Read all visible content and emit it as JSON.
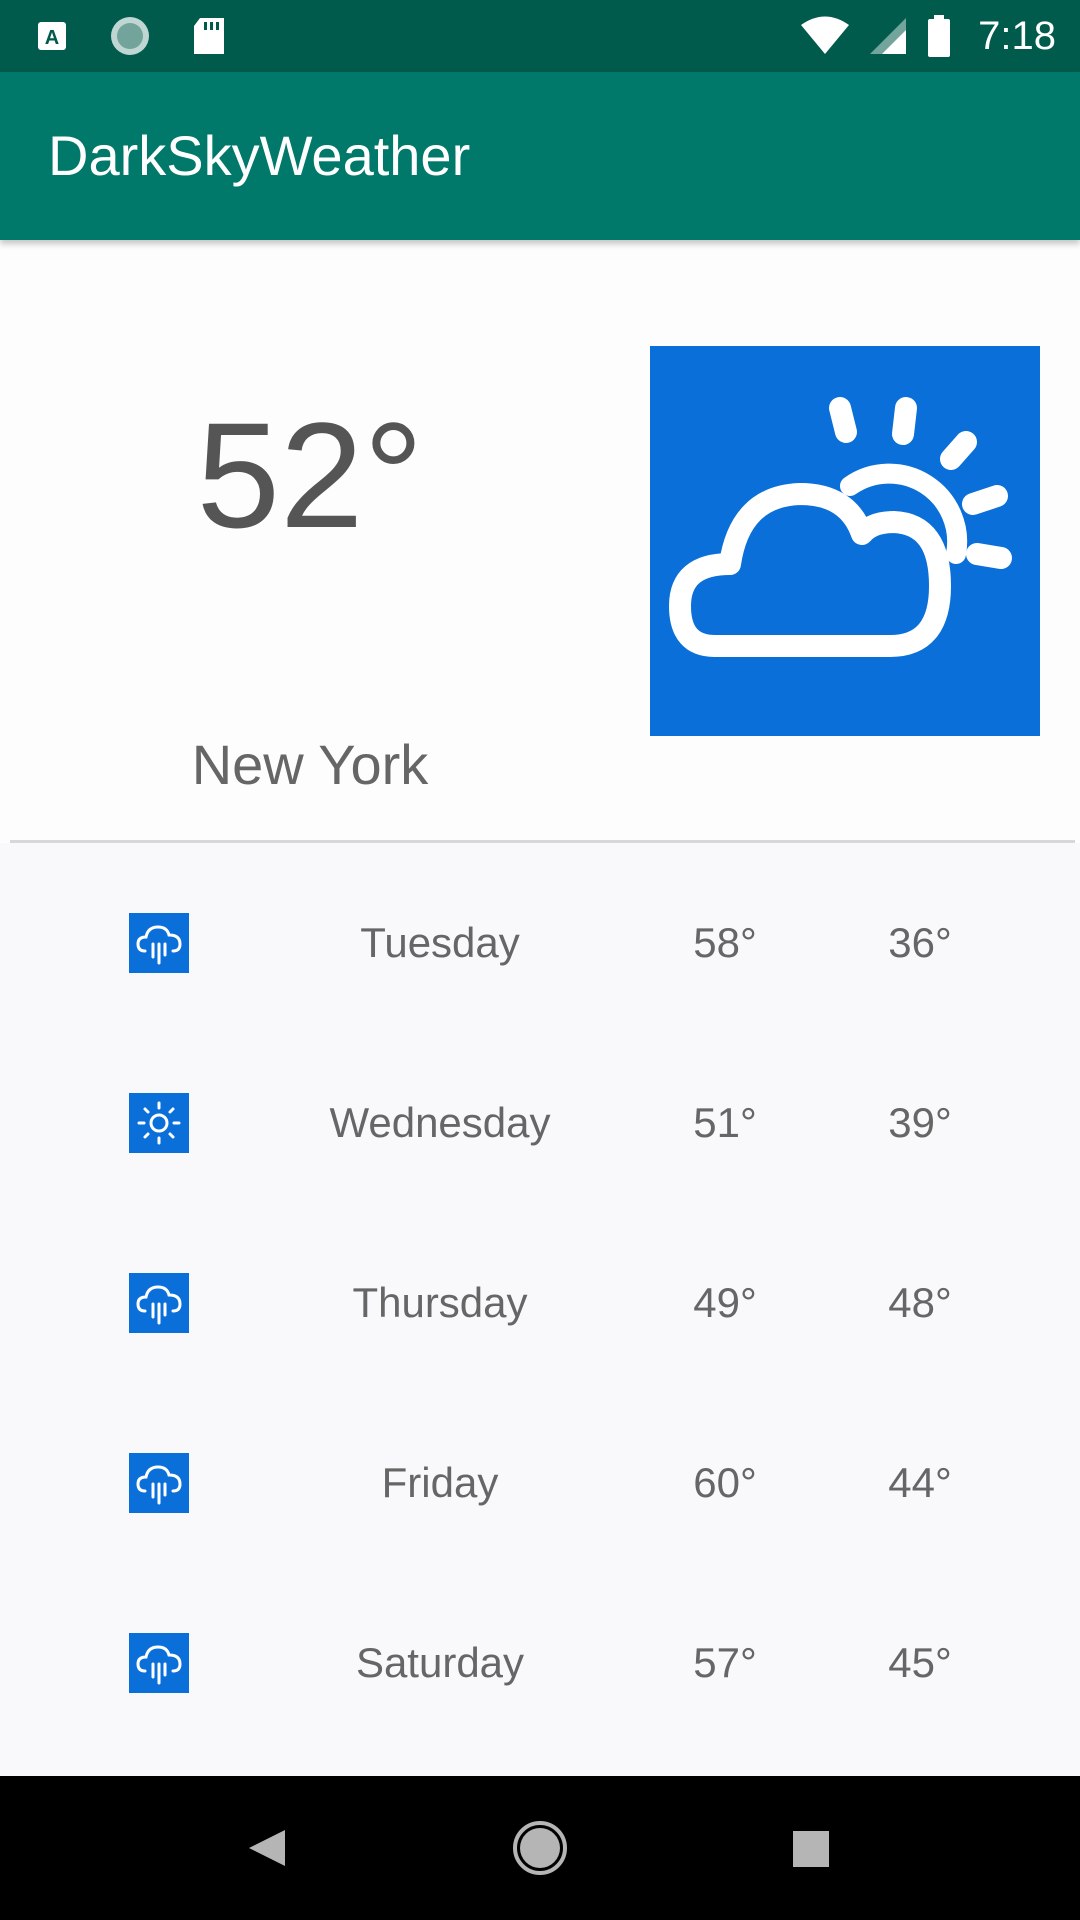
{
  "status_bar": {
    "time": "7:18",
    "icons": [
      "a-notification-icon",
      "sync-circle-icon",
      "sd-card-icon",
      "wifi-icon",
      "cell-signal-icon",
      "battery-icon"
    ]
  },
  "app_bar": {
    "title": "DarkSkyWeather"
  },
  "current": {
    "temperature": "52°",
    "city": "New York",
    "icon": "partly-cloudy-day-icon"
  },
  "forecast": [
    {
      "day": "Tuesday",
      "high": "58°",
      "low": "36°",
      "icon": "rain-icon"
    },
    {
      "day": "Wednesday",
      "high": "51°",
      "low": "39°",
      "icon": "clear-day-icon"
    },
    {
      "day": "Thursday",
      "high": "49°",
      "low": "48°",
      "icon": "rain-icon"
    },
    {
      "day": "Friday",
      "high": "60°",
      "low": "44°",
      "icon": "rain-icon"
    },
    {
      "day": "Saturday",
      "high": "57°",
      "low": "45°",
      "icon": "rain-icon"
    }
  ],
  "nav_bar": {
    "buttons": [
      "back-icon",
      "home-icon",
      "recents-icon"
    ]
  },
  "colors": {
    "status_bar": "#005b4c",
    "app_bar": "#00796b",
    "icon_background": "#0a6fd8",
    "text": "#666666"
  }
}
